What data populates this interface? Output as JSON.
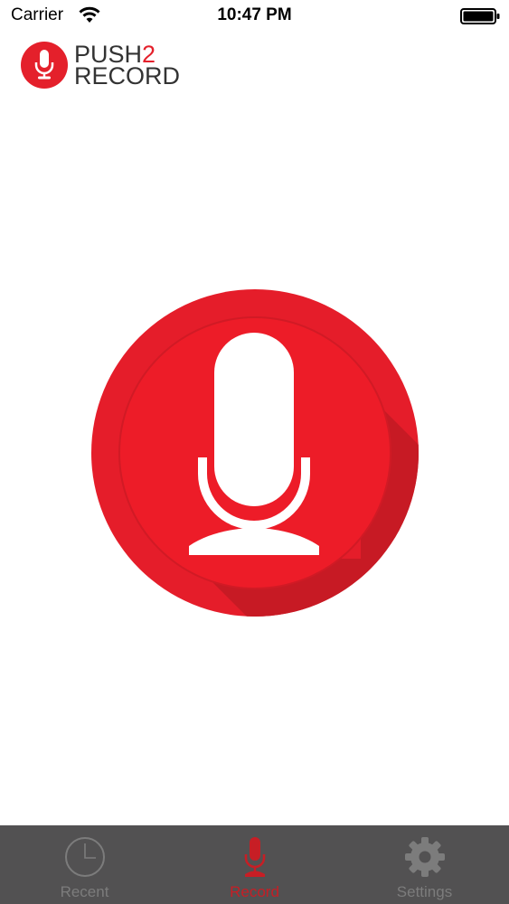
{
  "status_bar": {
    "carrier": "Carrier",
    "time": "10:47 PM"
  },
  "logo": {
    "word_1": "PUSH",
    "word_1_number": "2",
    "word_2": "RECORD"
  },
  "record": {
    "icon": "microphone-icon"
  },
  "tabs": [
    {
      "label": "Recent",
      "icon": "clock-icon",
      "active": false
    },
    {
      "label": "Record",
      "icon": "microphone-icon",
      "active": true
    },
    {
      "label": "Settings",
      "icon": "gear-icon",
      "active": false
    }
  ],
  "colors": {
    "brand_red": "#e4202b",
    "tab_bar": "#525152",
    "tab_inactive": "#7c7c7c",
    "tab_active": "#c71e25"
  }
}
